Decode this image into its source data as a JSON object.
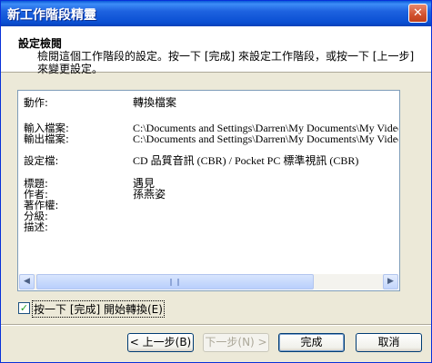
{
  "window": {
    "title": "新工作階段精靈",
    "close_glyph": "✕"
  },
  "header": {
    "title": "設定檢閱",
    "description": "檢閱這個工作階段的設定。按一下 [完成] 來設定工作階段，或按一下 [上一步] 來變更設定。"
  },
  "settings": {
    "action_label": "動作:",
    "action_value": "轉換檔案",
    "input_label": "輸入檔案:",
    "input_value": "C:\\Documents and Settings\\Darren\\My Documents\\My Videos\\",
    "output_label": "輸出檔案:",
    "output_value": "C:\\Documents and Settings\\Darren\\My Documents\\My Videos\\",
    "profile_label": "設定檔:",
    "profile_value": "CD 品質音訊 (CBR) / Pocket PC 標準視訊 (CBR)",
    "title_label": "標題:",
    "title_value": "遇見",
    "author_label": "作者:",
    "author_value": "孫燕姿",
    "copyright_label": "著作權:",
    "rating_label": "分級:",
    "desc_label": "描述:"
  },
  "scrollbar": {
    "left_glyph": "◀",
    "right_glyph": "▶"
  },
  "checkbox": {
    "checked": true,
    "check_glyph": "✓",
    "label": "按一下 [完成] 開始轉換(E)"
  },
  "buttons": {
    "back": "< 上一步(B)",
    "next": "下一步(N) >",
    "finish": "完成",
    "cancel": "取消"
  }
}
